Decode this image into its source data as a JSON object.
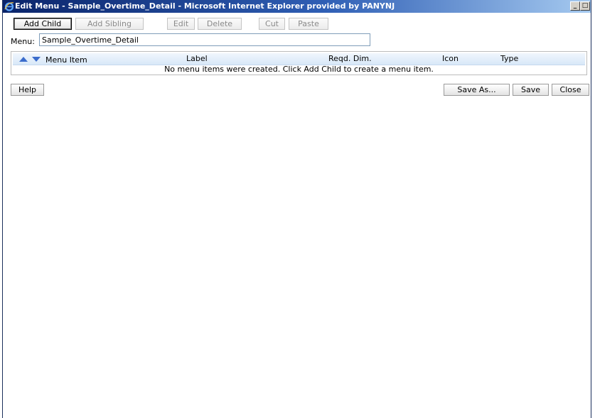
{
  "window": {
    "title": "Edit Menu - Sample_Overtime_Detail - Microsoft Internet Explorer provided by PANYNJ",
    "minimize": "_",
    "maximize": "□"
  },
  "toolbar": {
    "add_child": "Add Child",
    "add_sibling": "Add Sibling",
    "edit": "Edit",
    "delete": "Delete",
    "cut": "Cut",
    "paste": "Paste"
  },
  "menu": {
    "label": "Menu:",
    "value": "Sample_Overtime_Detail"
  },
  "grid": {
    "columns": [
      "Menu Item",
      "Label",
      "Reqd. Dim.",
      "Icon",
      "Type"
    ],
    "empty_message": "No menu items were created. Click Add Child to create a menu item."
  },
  "footer": {
    "help": "Help",
    "save_as": "Save As...",
    "save": "Save",
    "close": "Close"
  }
}
